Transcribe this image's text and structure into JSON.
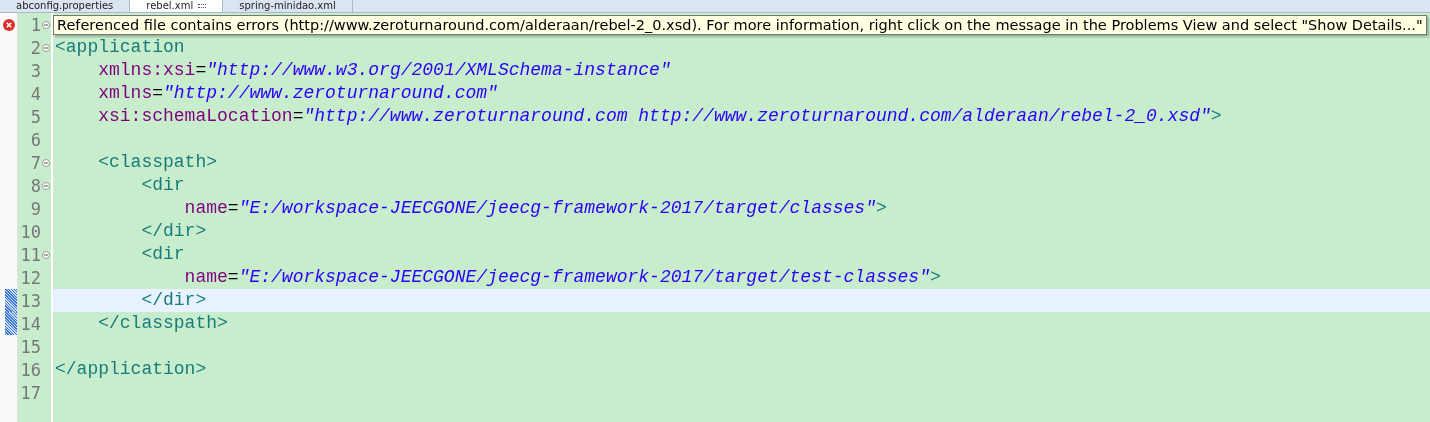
{
  "tabs": [
    {
      "label": "abconfig.properties",
      "selected": false
    },
    {
      "label": "rebel.xml",
      "selected": true,
      "dirty": true
    },
    {
      "label": "spring-minidao.xml",
      "selected": false
    }
  ],
  "tooltip": "Referenced file contains errors (http://www.zeroturnaround.com/alderaan/rebel-2_0.xsd). For more information, right click on the message in the Problems View and select \"Show Details...\"",
  "lines": [
    {
      "number": "1",
      "error": true,
      "foldable": true
    },
    {
      "number": "2",
      "foldable": true,
      "tokens": [
        {
          "kind": "tag",
          "text": "<application"
        }
      ]
    },
    {
      "number": "3",
      "tokens": [
        {
          "kind": "attr",
          "text": "    xmlns:xsi"
        },
        {
          "kind": "plain",
          "text": "="
        },
        {
          "kind": "value",
          "text": "\"http://www.w3.org/2001/XMLSchema-instance\""
        }
      ]
    },
    {
      "number": "4",
      "tokens": [
        {
          "kind": "attr",
          "text": "    xmlns"
        },
        {
          "kind": "plain",
          "text": "="
        },
        {
          "kind": "value",
          "text": "\"http://www.zeroturnaround.com\""
        }
      ]
    },
    {
      "number": "5",
      "tokens": [
        {
          "kind": "attr",
          "text": "    xsi:schemaLocation"
        },
        {
          "kind": "plain",
          "text": "="
        },
        {
          "kind": "value",
          "text": "\"http://www.zeroturnaround.com http://www.zeroturnaround.com/alderaan/rebel-2_0.xsd\""
        },
        {
          "kind": "tag",
          "text": ">"
        }
      ]
    },
    {
      "number": "6"
    },
    {
      "number": "7",
      "foldable": true,
      "tokens": [
        {
          "kind": "tag",
          "text": "    <classpath>"
        }
      ]
    },
    {
      "number": "8",
      "foldable": true,
      "tokens": [
        {
          "kind": "tag",
          "text": "        <dir"
        }
      ]
    },
    {
      "number": "9",
      "tokens": [
        {
          "kind": "attr",
          "text": "            name"
        },
        {
          "kind": "plain",
          "text": "="
        },
        {
          "kind": "value",
          "text": "\"E:/workspace-JEECGONE/jeecg-framework-2017/target/classes\""
        },
        {
          "kind": "tag",
          "text": ">"
        }
      ]
    },
    {
      "number": "10",
      "tokens": [
        {
          "kind": "tag",
          "text": "        </dir>"
        }
      ]
    },
    {
      "number": "11",
      "foldable": true,
      "tokens": [
        {
          "kind": "tag",
          "text": "        <dir"
        }
      ]
    },
    {
      "number": "12",
      "tokens": [
        {
          "kind": "attr",
          "text": "            name"
        },
        {
          "kind": "plain",
          "text": "="
        },
        {
          "kind": "value",
          "text": "\"E:/workspace-JEECGONE/jeecg-framework-2017/target/test-classes\""
        },
        {
          "kind": "tag",
          "text": ">"
        }
      ]
    },
    {
      "number": "13",
      "current": true,
      "changed": true,
      "tokens": [
        {
          "kind": "tag",
          "text": "        </dir>"
        }
      ]
    },
    {
      "number": "14",
      "changed": true,
      "tokens": [
        {
          "kind": "tag",
          "text": "    </classpath>"
        }
      ]
    },
    {
      "number": "15"
    },
    {
      "number": "16",
      "tokens": [
        {
          "kind": "tag",
          "text": "</application>"
        }
      ]
    },
    {
      "number": "17"
    }
  ]
}
